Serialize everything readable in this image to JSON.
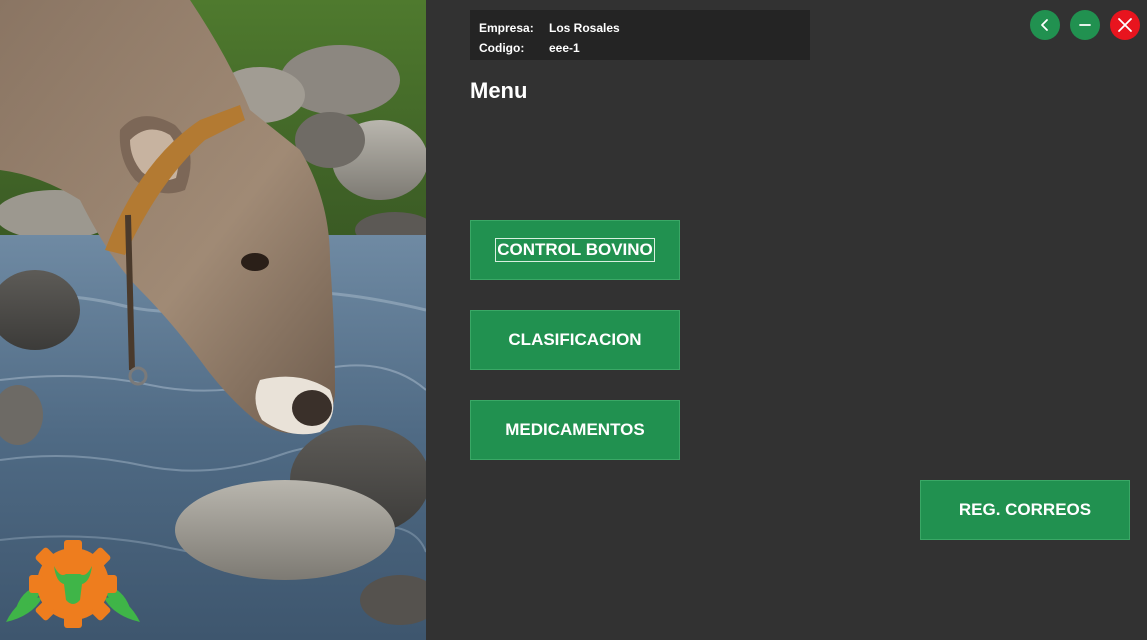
{
  "header": {
    "company_label": "Empresa:",
    "company_value": "Los Rosales",
    "code_label": "Codigo:",
    "code_value": "eee-1"
  },
  "menu": {
    "title": "Menu",
    "buttons": [
      {
        "label": "CONTROL BOVINO"
      },
      {
        "label": "CLASIFICACION"
      },
      {
        "label": "MEDICAMENTOS"
      },
      {
        "label": "REG. CORREOS"
      }
    ]
  },
  "window_controls": {
    "back_icon": "chevron-left-icon",
    "minimize_icon": "minus-icon",
    "close_icon": "close-icon"
  },
  "colors": {
    "background": "#323232",
    "info_box": "#242424",
    "accent_green": "#219150",
    "close_red": "#e8141e",
    "logo_orange": "#ee7d1e"
  }
}
